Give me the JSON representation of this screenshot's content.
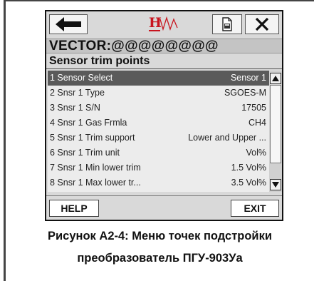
{
  "device": {
    "vector_title": "VECTOR:@@@@@@@@",
    "menu_title": "Sensor trim points",
    "items": [
      {
        "label": "1 Sensor Select",
        "value": "Sensor 1",
        "selected": true
      },
      {
        "label": "2 Snsr 1 Type",
        "value": "SGOES-M",
        "selected": false
      },
      {
        "label": "3 Snsr 1 S/N",
        "value": "17505",
        "selected": false
      },
      {
        "label": "4 Snsr 1 Gas Frmla",
        "value": "CH4",
        "selected": false
      },
      {
        "label": "5 Snsr 1 Trim support",
        "value": "Lower and Upper ...",
        "selected": false
      },
      {
        "label": "6 Snsr 1 Trim unit",
        "value": "Vol%",
        "selected": false
      },
      {
        "label": "7 Snsr 1 Min lower trim",
        "value": "1.5 Vol%",
        "selected": false
      },
      {
        "label": "8 Snsr 1 Max lower tr...",
        "value": "3.5 Vol%",
        "selected": false
      }
    ],
    "help_label": "HELP",
    "exit_label": "EXIT",
    "icons": {
      "back": "back-arrow-icon",
      "logo": "hart-logo-icon",
      "save": "document-icon",
      "close": "close-icon"
    },
    "colors": {
      "logo_red": "#c8141e",
      "selected_row": "#5a5a5a"
    }
  },
  "caption": {
    "line1": "Рисунок А2-4: Меню точек подстройки",
    "line2": "преобразователь ПГУ-903Уа"
  }
}
